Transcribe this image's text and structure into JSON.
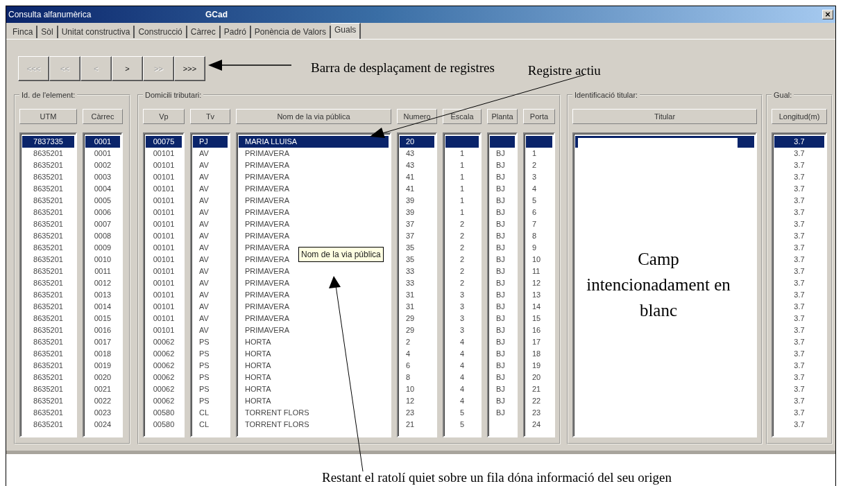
{
  "window": {
    "title": "Consulta alfanumèrica",
    "app": "GCad",
    "close": "×"
  },
  "tabs": [
    {
      "label": "Finca",
      "selected": false
    },
    {
      "label": "Sòl",
      "selected": false
    },
    {
      "label": "Unitat constructiva",
      "selected": false
    },
    {
      "label": "Construcció",
      "selected": false
    },
    {
      "label": "Càrrec",
      "selected": false
    },
    {
      "label": "Padró",
      "selected": false
    },
    {
      "label": "Ponència de Valors",
      "selected": false
    },
    {
      "label": "Guals",
      "selected": true
    }
  ],
  "nav_buttons": [
    {
      "label": "<<<",
      "disabled": true
    },
    {
      "label": "<<",
      "disabled": true
    },
    {
      "label": "<",
      "disabled": true
    },
    {
      "label": ">",
      "disabled": false
    },
    {
      "label": ">>",
      "disabled": true
    },
    {
      "label": ">>>",
      "disabled": false
    }
  ],
  "annotations": {
    "nav_bar": "Barra de desplaçament de registres",
    "active_record": "Registre actiu",
    "hover_hint": "Restant el ratolí quiet sobre un fila dóna informació del seu origen"
  },
  "tooltip": {
    "text": "Nom de la via pública"
  },
  "groups": [
    {
      "title": "Id. de l'element:",
      "columns": [
        {
          "header": "UTM"
        },
        {
          "header": "Càrrec"
        }
      ],
      "rows": [
        {
          "selected": true,
          "cells": [
            "7837335",
            "0001"
          ]
        },
        {
          "selected": false,
          "cells": [
            "8635201",
            "0001"
          ]
        },
        {
          "selected": false,
          "cells": [
            "8635201",
            "0002"
          ]
        },
        {
          "selected": false,
          "cells": [
            "8635201",
            "0003"
          ]
        },
        {
          "selected": false,
          "cells": [
            "8635201",
            "0004"
          ]
        },
        {
          "selected": false,
          "cells": [
            "8635201",
            "0005"
          ]
        },
        {
          "selected": false,
          "cells": [
            "8635201",
            "0006"
          ]
        },
        {
          "selected": false,
          "cells": [
            "8635201",
            "0007"
          ]
        },
        {
          "selected": false,
          "cells": [
            "8635201",
            "0008"
          ]
        },
        {
          "selected": false,
          "cells": [
            "8635201",
            "0009"
          ]
        },
        {
          "selected": false,
          "cells": [
            "8635201",
            "0010"
          ]
        },
        {
          "selected": false,
          "cells": [
            "8635201",
            "0011"
          ]
        },
        {
          "selected": false,
          "cells": [
            "8635201",
            "0012"
          ]
        },
        {
          "selected": false,
          "cells": [
            "8635201",
            "0013"
          ]
        },
        {
          "selected": false,
          "cells": [
            "8635201",
            "0014"
          ]
        },
        {
          "selected": false,
          "cells": [
            "8635201",
            "0015"
          ]
        },
        {
          "selected": false,
          "cells": [
            "8635201",
            "0016"
          ]
        },
        {
          "selected": false,
          "cells": [
            "8635201",
            "0017"
          ]
        },
        {
          "selected": false,
          "cells": [
            "8635201",
            "0018"
          ]
        },
        {
          "selected": false,
          "cells": [
            "8635201",
            "0019"
          ]
        },
        {
          "selected": false,
          "cells": [
            "8635201",
            "0020"
          ]
        },
        {
          "selected": false,
          "cells": [
            "8635201",
            "0021"
          ]
        },
        {
          "selected": false,
          "cells": [
            "8635201",
            "0022"
          ]
        },
        {
          "selected": false,
          "cells": [
            "8635201",
            "0023"
          ]
        },
        {
          "selected": false,
          "cells": [
            "8635201",
            "0024"
          ]
        }
      ]
    },
    {
      "title": "Domicili tributari:",
      "columns": [
        {
          "header": "Vp"
        },
        {
          "header": "Tv"
        },
        {
          "header": "Nom de la via pública"
        },
        {
          "header": "Numero"
        },
        {
          "header": "Escala"
        },
        {
          "header": "Planta"
        },
        {
          "header": "Porta"
        }
      ],
      "rows": [
        {
          "selected": true,
          "cells": [
            "00075",
            "PJ",
            "MARIA LLUISA",
            "20",
            null,
            null,
            null
          ]
        },
        {
          "selected": false,
          "cells": [
            "00101",
            "AV",
            "PRIMAVERA",
            "43",
            "1",
            "BJ",
            "1"
          ]
        },
        {
          "selected": false,
          "cells": [
            "00101",
            "AV",
            "PRIMAVERA",
            "43",
            "1",
            "BJ",
            "2"
          ]
        },
        {
          "selected": false,
          "cells": [
            "00101",
            "AV",
            "PRIMAVERA",
            "41",
            "1",
            "BJ",
            "3"
          ]
        },
        {
          "selected": false,
          "cells": [
            "00101",
            "AV",
            "PRIMAVERA",
            "41",
            "1",
            "BJ",
            "4"
          ]
        },
        {
          "selected": false,
          "cells": [
            "00101",
            "AV",
            "PRIMAVERA",
            "39",
            "1",
            "BJ",
            "5"
          ]
        },
        {
          "selected": false,
          "cells": [
            "00101",
            "AV",
            "PRIMAVERA",
            "39",
            "1",
            "BJ",
            "6"
          ]
        },
        {
          "selected": false,
          "cells": [
            "00101",
            "AV",
            "PRIMAVERA",
            "37",
            "2",
            "BJ",
            "7"
          ]
        },
        {
          "selected": false,
          "cells": [
            "00101",
            "AV",
            "PRIMAVERA",
            "37",
            "2",
            "BJ",
            "8"
          ]
        },
        {
          "selected": false,
          "cells": [
            "00101",
            "AV",
            "PRIMAVERA",
            "35",
            "2",
            "BJ",
            "9"
          ]
        },
        {
          "selected": false,
          "cells": [
            "00101",
            "AV",
            "PRIMAVERA",
            "35",
            "2",
            "BJ",
            "10"
          ]
        },
        {
          "selected": false,
          "cells": [
            "00101",
            "AV",
            "PRIMAVERA",
            "33",
            "2",
            "BJ",
            "11"
          ]
        },
        {
          "selected": false,
          "cells": [
            "00101",
            "AV",
            "PRIMAVERA",
            "33",
            "2",
            "BJ",
            "12"
          ]
        },
        {
          "selected": false,
          "cells": [
            "00101",
            "AV",
            "PRIMAVERA",
            "31",
            "3",
            "BJ",
            "13"
          ]
        },
        {
          "selected": false,
          "cells": [
            "00101",
            "AV",
            "PRIMAVERA",
            "31",
            "3",
            "BJ",
            "14"
          ]
        },
        {
          "selected": false,
          "cells": [
            "00101",
            "AV",
            "PRIMAVERA",
            "29",
            "3",
            "BJ",
            "15"
          ]
        },
        {
          "selected": false,
          "cells": [
            "00101",
            "AV",
            "PRIMAVERA",
            "29",
            "3",
            "BJ",
            "16"
          ]
        },
        {
          "selected": false,
          "cells": [
            "00062",
            "PS",
            "HORTA",
            "2",
            "4",
            "BJ",
            "17"
          ]
        },
        {
          "selected": false,
          "cells": [
            "00062",
            "PS",
            "HORTA",
            "4",
            "4",
            "BJ",
            "18"
          ]
        },
        {
          "selected": false,
          "cells": [
            "00062",
            "PS",
            "HORTA",
            "6",
            "4",
            "BJ",
            "19"
          ]
        },
        {
          "selected": false,
          "cells": [
            "00062",
            "PS",
            "HORTA",
            "8",
            "4",
            "BJ",
            "20"
          ]
        },
        {
          "selected": false,
          "cells": [
            "00062",
            "PS",
            "HORTA",
            "10",
            "4",
            "BJ",
            "21"
          ]
        },
        {
          "selected": false,
          "cells": [
            "00062",
            "PS",
            "HORTA",
            "12",
            "4",
            "BJ",
            "22"
          ]
        },
        {
          "selected": false,
          "cells": [
            "00580",
            "CL",
            "TORRENT FLORS",
            "23",
            "5",
            "BJ",
            "23"
          ]
        },
        {
          "selected": false,
          "cells": [
            "00580",
            "CL",
            "TORRENT FLORS",
            "21",
            "5",
            null,
            "24"
          ]
        }
      ]
    },
    {
      "title": "Identificació titular:",
      "cover_note": "Camp intencionadament en blanc",
      "columns": [
        {
          "header": "Titular"
        }
      ],
      "rows": [
        {
          "selected": true,
          "cells": [
            null
          ]
        }
      ]
    },
    {
      "title": "Gual:",
      "columns": [
        {
          "header": "Longitud(m)"
        }
      ],
      "rows": [
        {
          "selected": true,
          "cells": [
            "3.7"
          ]
        },
        {
          "selected": false,
          "cells": [
            "3.7"
          ]
        },
        {
          "selected": false,
          "cells": [
            "3.7"
          ]
        },
        {
          "selected": false,
          "cells": [
            "3.7"
          ]
        },
        {
          "selected": false,
          "cells": [
            "3.7"
          ]
        },
        {
          "selected": false,
          "cells": [
            "3.7"
          ]
        },
        {
          "selected": false,
          "cells": [
            "3.7"
          ]
        },
        {
          "selected": false,
          "cells": [
            "3.7"
          ]
        },
        {
          "selected": false,
          "cells": [
            "3.7"
          ]
        },
        {
          "selected": false,
          "cells": [
            "3.7"
          ]
        },
        {
          "selected": false,
          "cells": [
            "3.7"
          ]
        },
        {
          "selected": false,
          "cells": [
            "3.7"
          ]
        },
        {
          "selected": false,
          "cells": [
            "3.7"
          ]
        },
        {
          "selected": false,
          "cells": [
            "3.7"
          ]
        },
        {
          "selected": false,
          "cells": [
            "3.7"
          ]
        },
        {
          "selected": false,
          "cells": [
            "3.7"
          ]
        },
        {
          "selected": false,
          "cells": [
            "3.7"
          ]
        },
        {
          "selected": false,
          "cells": [
            "3.7"
          ]
        },
        {
          "selected": false,
          "cells": [
            "3.7"
          ]
        },
        {
          "selected": false,
          "cells": [
            "3.7"
          ]
        },
        {
          "selected": false,
          "cells": [
            "3.7"
          ]
        },
        {
          "selected": false,
          "cells": [
            "3.7"
          ]
        },
        {
          "selected": false,
          "cells": [
            "3.7"
          ]
        },
        {
          "selected": false,
          "cells": [
            "3.7"
          ]
        },
        {
          "selected": false,
          "cells": [
            "3.7"
          ]
        }
      ]
    }
  ]
}
